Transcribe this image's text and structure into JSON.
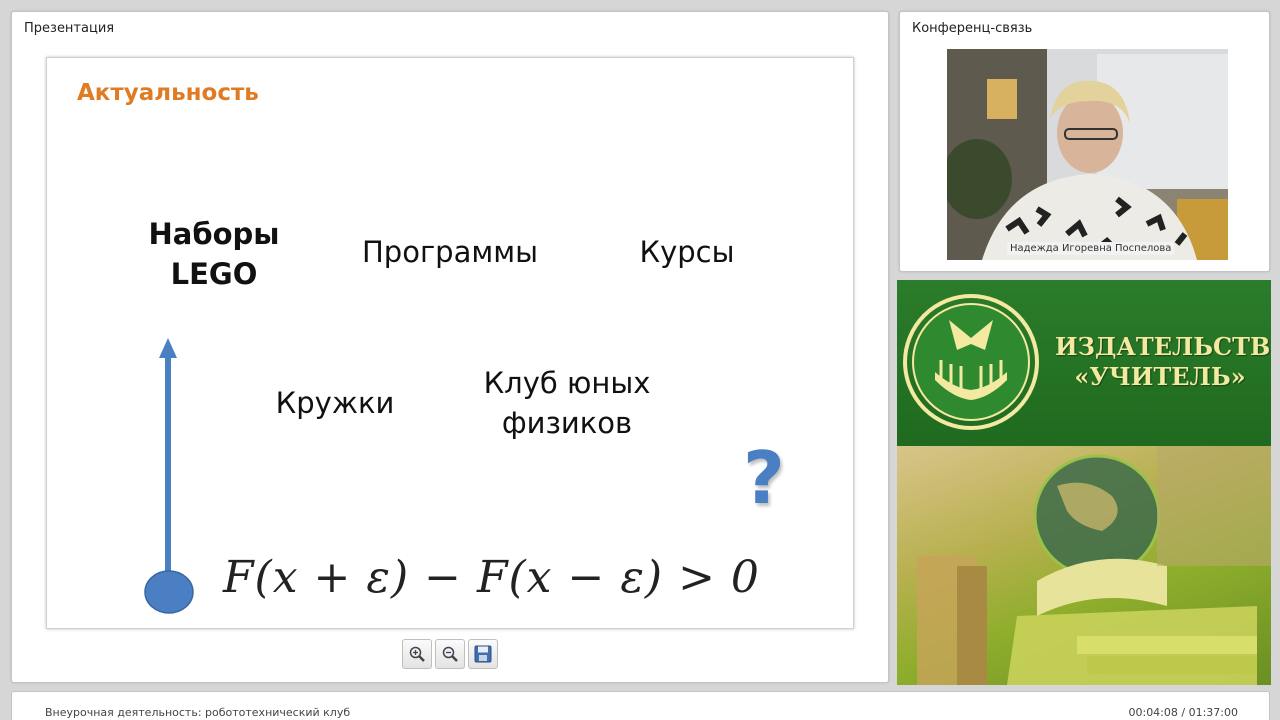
{
  "presentation": {
    "panel_title": "Презентация",
    "slide": {
      "heading": "Актуальность",
      "items": {
        "lego": "Наборы\nLEGO",
        "programs": "Программы",
        "courses": "Курсы",
        "circles": "Кружки",
        "club": "Клуб юных\nфизиков"
      },
      "question_mark": "?",
      "formula": "F(x + ε) − F(x − ε) > 0",
      "accent_color": "#e07b24",
      "arrow_color": "#4a7fc4"
    },
    "toolbar": {
      "zoom_in_icon": "zoom-in-icon",
      "zoom_out_icon": "zoom-out-icon",
      "save_icon": "save-icon"
    }
  },
  "conference": {
    "panel_title": "Конференц-связь",
    "participant_name": "Надежда Игоревна Поспелова"
  },
  "banner": {
    "publisher_text": "ИЗДАТЕЛЬСТВО\n«УЧИТЕЛЬ»"
  },
  "status": {
    "title": "Внеурочная деятельность: робототехнический клуб",
    "time": "00:04:08 / 01:37:00"
  }
}
